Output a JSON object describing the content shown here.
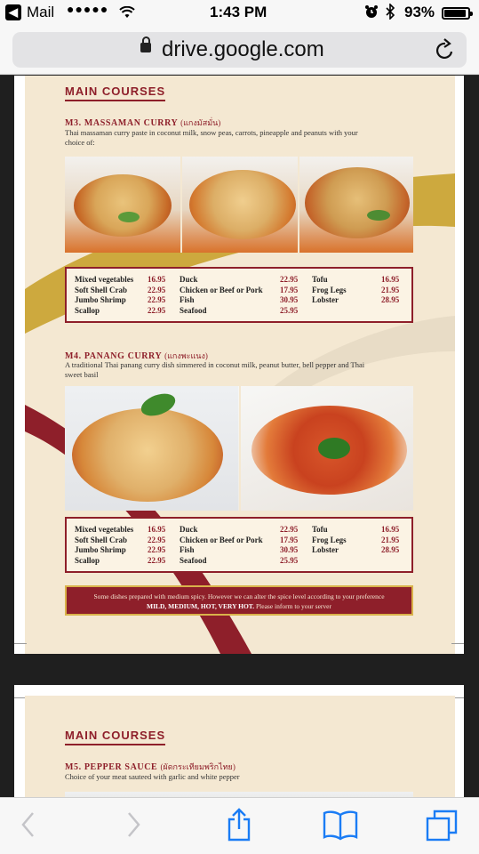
{
  "status": {
    "back_app": "Mail",
    "signal_dots": "●●●●●",
    "time": "1:43 PM",
    "battery_pct": "93%",
    "battery_level": 0.93
  },
  "browser": {
    "url": "drive.google.com"
  },
  "menu_page1": {
    "section_title": "MAIN COURSES",
    "dish1": {
      "name": "M3. MASSAMAN CURRY",
      "thai": "(แกงมัสมั่น)",
      "desc": "Thai massaman curry paste in coconut milk, snow peas, carrots, pineapple and peanuts with your choice of:"
    },
    "dish2": {
      "name": "M4. PANANG CURRY",
      "thai": "(แกงพะแนง)",
      "desc": "A traditional Thai panang curry dish simmered in coconut milk, peanut butter, bell pepper and Thai sweet basil"
    },
    "prices": [
      [
        {
          "item": "Mixed vegetables",
          "price": "16.95"
        },
        {
          "item": "Soft Shell Crab",
          "price": "22.95"
        },
        {
          "item": "Jumbo Shrimp",
          "price": "22.95"
        },
        {
          "item": "Scallop",
          "price": "22.95"
        }
      ],
      [
        {
          "item": "Duck",
          "price": "22.95"
        },
        {
          "item": "Chicken or Beef or Pork",
          "price": "17.95"
        },
        {
          "item": "Fish",
          "price": "30.95"
        },
        {
          "item": "Seafood",
          "price": "25.95"
        }
      ],
      [
        {
          "item": "Tofu",
          "price": "16.95"
        },
        {
          "item": "Frog Legs",
          "price": "21.95"
        },
        {
          "item": "Lobster",
          "price": "28.95"
        }
      ]
    ],
    "notice_line1": "Some dishes prepared with medium spicy. However we can alter the spice level according to your preference",
    "notice_bold": "MILD, MEDIUM, HOT, VERY HOT.",
    "notice_line2_rest": " Please inform to your server"
  },
  "menu_page2": {
    "section_title": "MAIN COURSES",
    "dish1": {
      "name": "M5. PEPPER SAUCE",
      "thai": "(ผัดกระเทียมพริกไทย)",
      "desc": "Choice of your meat sauteed with garlic and white pepper"
    }
  },
  "colors": {
    "accent": "#8e1f2a",
    "gold": "#c9a22e",
    "paper": "#f4e8d2",
    "ios_blue": "#1a7cf5"
  },
  "icons": [
    "back-arrow-icon",
    "wifi-icon",
    "alarm-icon",
    "bluetooth-icon",
    "battery-icon",
    "lock-icon",
    "reload-icon",
    "chevron-left-icon",
    "chevron-right-icon",
    "share-icon",
    "bookmarks-icon",
    "tabs-icon"
  ]
}
